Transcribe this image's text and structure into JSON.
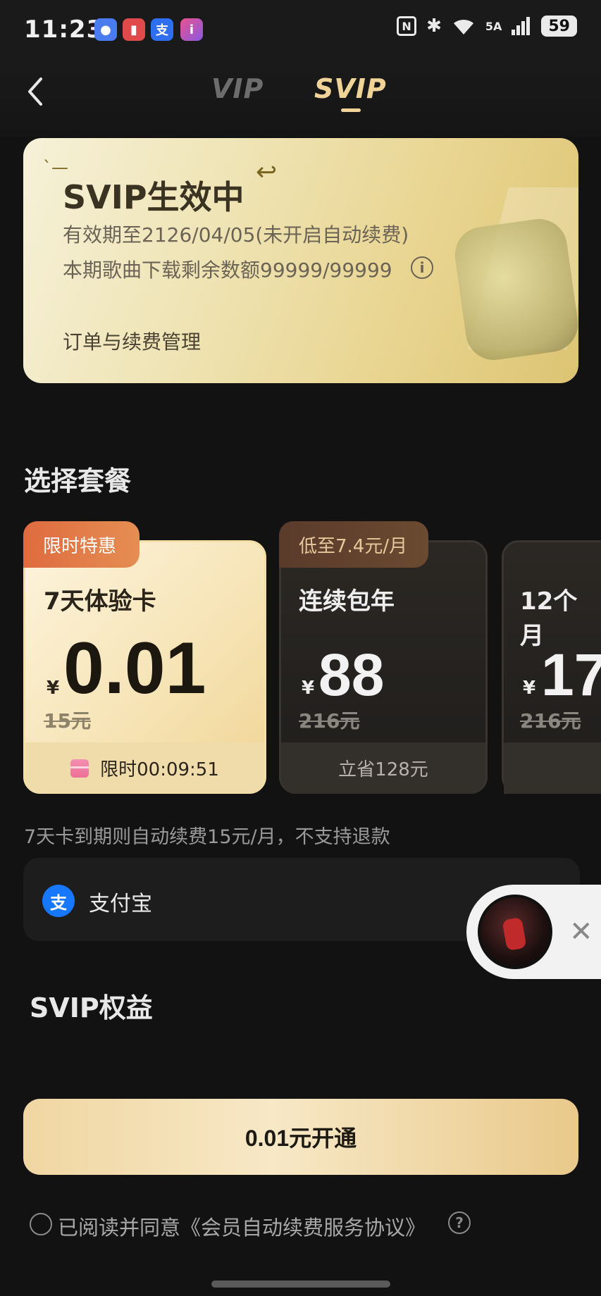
{
  "status_bar": {
    "time": "11:23",
    "notification_icons": [
      {
        "name": "message-icon",
        "glyph": "💬",
        "color": "#4a7cf0"
      },
      {
        "name": "book-icon",
        "glyph": "📖",
        "color": "#e04a4a"
      },
      {
        "name": "alipay-icon",
        "glyph": "支",
        "color": "#2e6ff2"
      },
      {
        "name": "app-icon",
        "glyph": "i",
        "color": "#b35ad9"
      }
    ],
    "nfc": "N",
    "bluetooth": "✱",
    "wifi": "📶",
    "signal_label": "5A",
    "battery": "59"
  },
  "header": {
    "tabs": [
      {
        "label": "VIP",
        "active": false
      },
      {
        "label": "SVIP",
        "active": true
      }
    ],
    "back_glyph": "‹"
  },
  "member_card": {
    "title": "SVIP生效中",
    "validity": "有效期至2126/04/05(未开启自动续费)",
    "quota": "本期歌曲下载剩余数额99999/99999",
    "info_glyph": "i",
    "manage_link": "订单与续费管理"
  },
  "plans_section": {
    "title": "选择套餐",
    "plans": [
      {
        "badge": "限时特惠",
        "name": "7天体验卡",
        "currency": "¥",
        "price": "0.01",
        "original": "15元",
        "footer": "限时00:09:51",
        "selected": true
      },
      {
        "badge": "低至7.4元/月",
        "name": "连续包年",
        "currency": "¥",
        "price": "88",
        "original": "216元",
        "footer": "立省128元",
        "selected": false
      },
      {
        "badge": "",
        "name": "12个月",
        "currency": "¥",
        "price": "17",
        "original": "216元",
        "footer": "",
        "selected": false
      }
    ],
    "notice": "7天卡到期则自动续费15元/月，不支持退款"
  },
  "payment": {
    "method_icon": "支",
    "method_label": "支付宝"
  },
  "floating_player": {
    "close_glyph": "✕"
  },
  "benefits": {
    "title": "SVIP权益"
  },
  "cta": {
    "label": "0.01元开通"
  },
  "agreement": {
    "text": "已阅读并同意《会员自动续费服务协议》",
    "help_glyph": "?"
  },
  "colors": {
    "background": "#121212",
    "gold_accent": "#f0d497",
    "cta_gradient_start": "#f0d6a2",
    "badge_orange": "#de6b3f"
  }
}
